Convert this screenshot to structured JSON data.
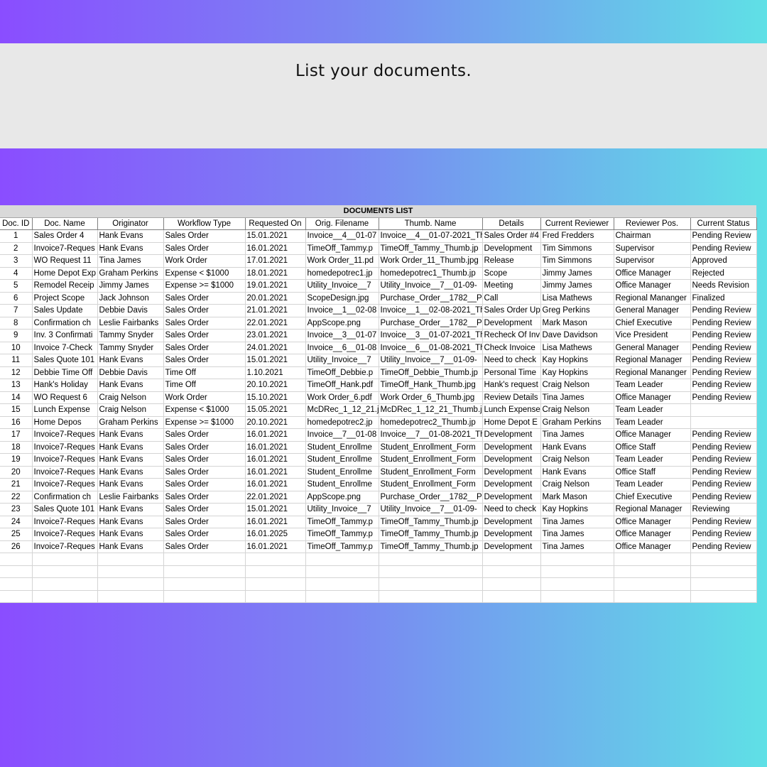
{
  "banner": {
    "text": "List your documents."
  },
  "table": {
    "title": "DOCUMENTS LIST",
    "columns": [
      "Doc. ID",
      "Doc. Name",
      "Originator",
      "Workflow Type",
      "Requested On",
      "Orig. Filename",
      "Thumb. Name",
      "Details",
      "Current Reviewer",
      "Reviewer Pos.",
      "Current Status"
    ],
    "rows": [
      [
        "1",
        "Sales Order 4",
        "Hank Evans",
        "Sales Order",
        "15.01.2021",
        "Invoice__4__01-07",
        "Invoice__4__01-07-2021_Th",
        "Sales Order #4",
        "Fred Fredders",
        "Chairman",
        "Pending Review"
      ],
      [
        "2",
        "Invoice7-Reques",
        "Hank Evans",
        "Sales Order",
        "16.01.2021",
        "TimeOff_Tammy.p",
        "TimeOff_Tammy_Thumb.jp",
        "Development",
        "Tim Simmons",
        "Supervisor",
        "Pending Review"
      ],
      [
        "3",
        "WO Request 11",
        "Tina James",
        "Work Order",
        "17.01.2021",
        "Work Order_11.pd",
        "Work Order_11_Thumb.jpg",
        "Release",
        "Tim Simmons",
        "Supervisor",
        "Approved"
      ],
      [
        "4",
        "Home Depot Exp",
        "Graham Perkins",
        "Expense < $1000",
        "18.01.2021",
        "homedepotrec1.jp",
        "homedepotrec1_Thumb.jp",
        "Scope",
        "Jimmy James",
        "Office Manager",
        "Rejected"
      ],
      [
        "5",
        "Remodel Receip",
        "Jimmy James",
        "Expense >= $1000",
        "19.01.2021",
        "Utility_Invoice__7",
        "Utility_Invoice__7__01-09-",
        "Meeting",
        "Jimmy James",
        "Office Manager",
        "Needs Revision"
      ],
      [
        "6",
        "Project Scope",
        "Jack Johnson",
        "Sales Order",
        "20.01.2021",
        "ScopeDesign.jpg",
        "Purchase_Order__1782__P",
        "Call",
        "Lisa Mathews",
        "Regional Mananger",
        "Finalized"
      ],
      [
        "7",
        "Sales Update",
        "Debbie Davis",
        "Sales Order",
        "21.01.2021",
        "Invoice__1__02-08",
        "Invoice__1__02-08-2021_Th",
        "Sales Order Up",
        "Greg Perkins",
        "General Manager",
        "Pending Review"
      ],
      [
        "8",
        "Confirmation ch",
        "Leslie Fairbanks",
        "Sales Order",
        "22.01.2021",
        "AppScope.png",
        "Purchase_Order__1782__P",
        "Development",
        "Mark Mason",
        "Chief Executive",
        "Pending Review"
      ],
      [
        "9",
        "Inv. 3 Confirmati",
        "Tammy Snyder",
        "Sales Order",
        "23.01.2021",
        "Invoice__3__01-07",
        "Invoice__3__01-07-2021_Th",
        "Recheck Of Inv",
        "Dave Davidson",
        "Vice President",
        "Pending Review"
      ],
      [
        "10",
        "Invoice 7-Check",
        "Tammy Snyder",
        "Sales Order",
        "24.01.2021",
        "Invoice__6__01-08",
        "Invoice__6__01-08-2021_Th",
        "Check Invoice",
        "Lisa Mathews",
        "General Manager",
        "Pending Review"
      ],
      [
        "11",
        "Sales Quote 101",
        "Hank Evans",
        "Sales Order",
        "15.01.2021",
        "Utility_Invoice__7",
        "Utility_Invoice__7__01-09-",
        "Need to check",
        "Kay Hopkins",
        "Regional Manager",
        "Pending Review"
      ],
      [
        "12",
        "Debbie Time Off",
        "Debbie Davis",
        "Time Off",
        "1.10.2021",
        "TimeOff_Debbie.p",
        "TimeOff_Debbie_Thumb.jp",
        "Personal Time",
        "Kay Hopkins",
        "Regional Mananger",
        "Pending Review"
      ],
      [
        "13",
        "Hank's Holiday",
        "Hank Evans",
        "Time Off",
        "20.10.2021",
        "TimeOff_Hank.pdf",
        "TimeOff_Hank_Thumb.jpg",
        "Hank's request",
        "Craig Nelson",
        "Team Leader",
        "Pending Review"
      ],
      [
        "14",
        "WO Request 6",
        "Craig Nelson",
        "Work Order",
        "15.10.2021",
        "Work Order_6.pdf",
        "Work Order_6_Thumb.jpg",
        "Review Details",
        "Tina James",
        "Office Manager",
        "Pending Review"
      ],
      [
        "15",
        "Lunch Expense",
        "Craig Nelson",
        "Expense < $1000",
        "15.05.2021",
        "McDRec_1_12_21.j",
        "McDRec_1_12_21_Thumb.j",
        "Lunch Expense",
        "Craig Nelson",
        "Team Leader",
        ""
      ],
      [
        "16",
        "Home Depos",
        "Graham Perkins",
        "Expense >= $1000",
        "20.10.2021",
        "homedepotrec2.jp",
        "homedepotrec2_Thumb.jp",
        "Home Depot E",
        "Graham Perkins",
        "Team Leader",
        ""
      ],
      [
        "17",
        "Invoice7-Reques",
        "Hank Evans",
        "Sales Order",
        "16.01.2021",
        "Invoice__7__01-08",
        "Invoice__7__01-08-2021_Th",
        "Development",
        "Tina James",
        "Office Manager",
        "Pending Review"
      ],
      [
        "18",
        "Invoice7-Reques",
        "Hank Evans",
        "Sales Order",
        "16.01.2021",
        "Student_Enrollme",
        "Student_Enrollment_Form",
        "Development",
        "Hank Evans",
        "Office Staff",
        "Pending Review"
      ],
      [
        "19",
        "Invoice7-Reques",
        "Hank Evans",
        "Sales Order",
        "16.01.2021",
        "Student_Enrollme",
        "Student_Enrollment_Form",
        "Development",
        "Craig Nelson",
        "Team Leader",
        "Pending Review"
      ],
      [
        "20",
        "Invoice7-Reques",
        "Hank Evans",
        "Sales Order",
        "16.01.2021",
        "Student_Enrollme",
        "Student_Enrollment_Form",
        "Development",
        "Hank Evans",
        "Office Staff",
        "Pending Review"
      ],
      [
        "21",
        "Invoice7-Reques",
        "Hank Evans",
        "Sales Order",
        "16.01.2021",
        "Student_Enrollme",
        "Student_Enrollment_Form",
        "Development",
        "Craig Nelson",
        "Team Leader",
        "Pending Review"
      ],
      [
        "22",
        "Confirmation ch",
        "Leslie Fairbanks",
        "Sales Order",
        "22.01.2021",
        "AppScope.png",
        "Purchase_Order__1782__P",
        "Development",
        "Mark Mason",
        "Chief Executive",
        "Pending Review"
      ],
      [
        "23",
        "Sales Quote 101",
        "Hank Evans",
        "Sales Order",
        "15.01.2021",
        "Utility_Invoice__7",
        "Utility_Invoice__7__01-09-",
        "Need to check",
        "Kay Hopkins",
        "Regional Manager",
        "Reviewing"
      ],
      [
        "24",
        "Invoice7-Reques",
        "Hank Evans",
        "Sales Order",
        "16.01.2021",
        "TimeOff_Tammy.p",
        "TimeOff_Tammy_Thumb.jp",
        "Development",
        "Tina James",
        "Office Manager",
        "Pending Review"
      ],
      [
        "25",
        "Invoice7-Reques",
        "Hank Evans",
        "Sales Order",
        "16.01.2025",
        "TimeOff_Tammy.p",
        "TimeOff_Tammy_Thumb.jp",
        "Development",
        "Tina James",
        "Office Manager",
        "Pending Review"
      ],
      [
        "26",
        "Invoice7-Reques",
        "Hank Evans",
        "Sales Order",
        "16.01.2021",
        "TimeOff_Tammy.p",
        "TimeOff_Tammy_Thumb.jp",
        "Development",
        "Tina James",
        "Office Manager",
        "Pending Review"
      ]
    ]
  }
}
